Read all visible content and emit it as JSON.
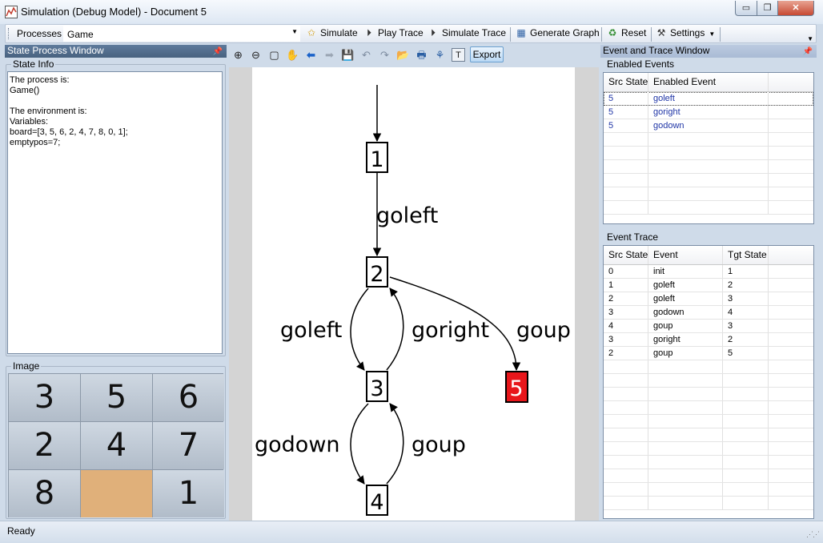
{
  "window": {
    "title": "Simulation (Debug Model) - Document 5",
    "minimize": "▭",
    "maximize": "❐",
    "close": "✕"
  },
  "toolbar": {
    "processes_label": "Processes",
    "process_value": "Game",
    "simulate": "Simulate",
    "play_trace": "Play Trace",
    "simulate_trace": "Simulate Trace",
    "generate_graph": "Generate Graph",
    "reset": "Reset",
    "settings": "Settings"
  },
  "left_panel": {
    "title": "State Process Window",
    "state_info_label": "State Info",
    "state_info_text": "The process is:\nGame()\n\nThe environment is:\nVariables:\nboard=[3, 5, 6, 2, 4, 7, 8, 0, 1];\nemptypos=7;",
    "image_label": "Image",
    "tiles": [
      "3",
      "5",
      "6",
      "2",
      "4",
      "7",
      "8",
      "",
      "1"
    ]
  },
  "graph_toolbar": {
    "icons": [
      "zoom-in-icon",
      "zoom-out-icon",
      "select-rect-icon",
      "hand-pan-icon",
      "back-arrow-icon",
      "forward-arrow-icon",
      "save-icon",
      "undo-icon",
      "redo-icon",
      "open-folder-icon",
      "print-icon",
      "layout-tree-icon",
      "text-icon"
    ],
    "text_button": "T",
    "export": "Export"
  },
  "graph": {
    "nodes": [
      {
        "id": "1",
        "label": "1",
        "highlight": false
      },
      {
        "id": "2",
        "label": "2",
        "highlight": false
      },
      {
        "id": "3",
        "label": "3",
        "highlight": false
      },
      {
        "id": "4",
        "label": "4",
        "highlight": false
      },
      {
        "id": "5",
        "label": "5",
        "highlight": true
      }
    ],
    "edges": [
      {
        "from": "1",
        "to": "2",
        "label": "goleft"
      },
      {
        "from": "2",
        "to": "3",
        "label": "goleft"
      },
      {
        "from": "3",
        "to": "2",
        "label": "goright"
      },
      {
        "from": "2",
        "to": "5",
        "label": "goup"
      },
      {
        "from": "3",
        "to": "4",
        "label": "godown"
      },
      {
        "from": "4",
        "to": "3",
        "label": "goup"
      }
    ],
    "highlight_color": "#e8161b"
  },
  "right_panel": {
    "title": "Event and Trace Window",
    "enabled_events_label": "Enabled Events",
    "enabled_events_headers": [
      "Src State",
      "Enabled Event"
    ],
    "enabled_events": [
      {
        "src": "5",
        "event": "goleft"
      },
      {
        "src": "5",
        "event": "goright"
      },
      {
        "src": "5",
        "event": "godown"
      }
    ],
    "event_trace_label": "Event Trace",
    "event_trace_headers": [
      "Src State",
      "Event",
      "Tgt State"
    ],
    "event_trace": [
      {
        "src": "0",
        "event": "init",
        "tgt": "1"
      },
      {
        "src": "1",
        "event": "goleft",
        "tgt": "2"
      },
      {
        "src": "2",
        "event": "goleft",
        "tgt": "3"
      },
      {
        "src": "3",
        "event": "godown",
        "tgt": "4"
      },
      {
        "src": "4",
        "event": "goup",
        "tgt": "3"
      },
      {
        "src": "3",
        "event": "goright",
        "tgt": "2"
      },
      {
        "src": "2",
        "event": "goup",
        "tgt": "5"
      }
    ]
  },
  "status": {
    "text": "Ready"
  }
}
